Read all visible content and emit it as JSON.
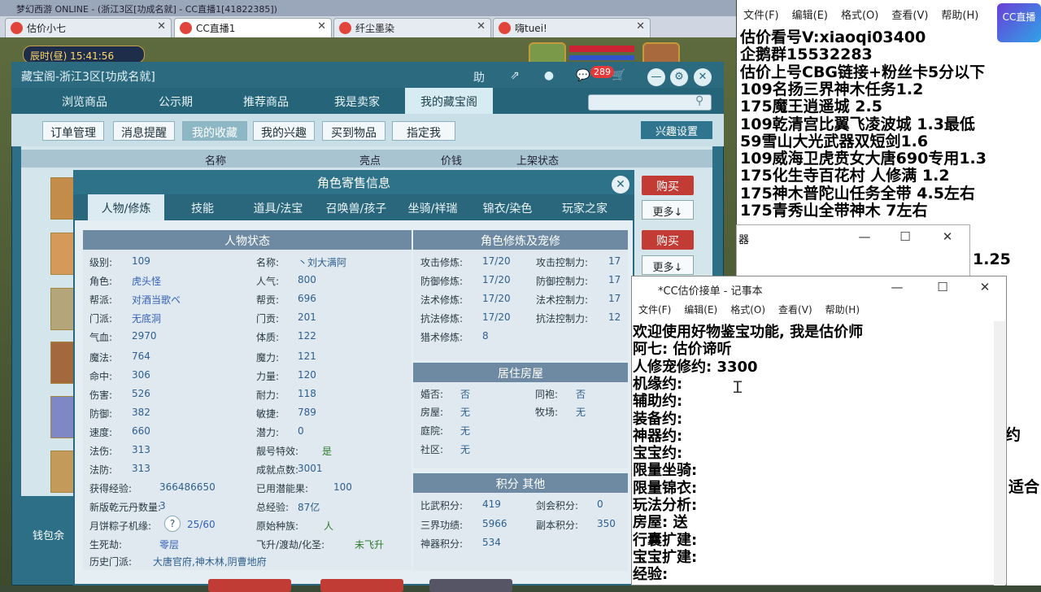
{
  "browser": {
    "window_title": "梦幻西游 ONLINE - (浙江3区[功成名就] - CC直播1[41822385])",
    "tabs": [
      {
        "label": "估价小七"
      },
      {
        "label": "CC直播1"
      },
      {
        "label": "纤尘墨染"
      },
      {
        "label": "嗨tuei!"
      }
    ]
  },
  "game": {
    "clock": "辰时(昼) 15:41:56",
    "cbg": {
      "title": "藏宝阁-浙江3区[功成名就]",
      "top_icons": {
        "help": "助",
        "share": "⇗",
        "stop": "●",
        "chat": "💬",
        "cart": "🛒"
      },
      "badge": "289",
      "nav_tabs": [
        "浏览商品",
        "公示期",
        "推荐商品",
        "我是卖家",
        "我的藏宝阁"
      ],
      "sub_tabs": [
        "订单管理",
        "消息提醒",
        "我的收藏",
        "我的兴趣",
        "买到物品",
        "指定我"
      ],
      "interest_button": "兴趣设置",
      "columns": [
        "名称",
        "亮点",
        "价钱",
        "上架状态"
      ],
      "buy_label": "购买",
      "more_label": "更多↓",
      "wallet": "钱包余"
    },
    "role": {
      "title": "角色寄售信息",
      "close": "✕",
      "tabs": [
        "人物/修炼",
        "技能",
        "道具/法宝",
        "召唤兽/孩子",
        "坐骑/祥瑞",
        "锦衣/染色",
        "玩家之家"
      ],
      "sections": {
        "status": "人物状态",
        "cultivation": "角色修炼及宠修",
        "house": "居住房屋",
        "points": "积分 其他"
      },
      "left": [
        [
          "级别:",
          "109",
          "名称:",
          "丶刘大满阿"
        ],
        [
          "角色:",
          "虎头怪",
          "人气:",
          "800"
        ],
        [
          "帮派:",
          "对酒当歌ベ",
          "帮贡:",
          "696"
        ],
        [
          "门派:",
          "无底洞",
          "门贡:",
          "201"
        ],
        [
          "气血:",
          "2970",
          "体质:",
          "122"
        ],
        [
          "魔法:",
          "764",
          "魔力:",
          "121"
        ],
        [
          "命中:",
          "306",
          "力量:",
          "120"
        ],
        [
          "伤害:",
          "526",
          "耐力:",
          "118"
        ],
        [
          "防御:",
          "382",
          "敏捷:",
          "789"
        ],
        [
          "速度:",
          "660",
          "潜力:",
          "0"
        ],
        [
          "法伤:",
          "313",
          "靓号特效:",
          "是"
        ],
        [
          "法防:",
          "313",
          "成就点数:",
          "3001"
        ],
        [
          "获得经验:",
          "366486650",
          "已用潜能果:",
          "100"
        ],
        [
          "新版乾元丹数量:",
          "3",
          "总经验:",
          "87亿"
        ],
        [
          "月饼粽子机缘:",
          "25/60",
          "原始种族:",
          "人"
        ],
        [
          "生死劫:",
          "零层",
          "飞升/渡劫/化圣:",
          "未飞升"
        ]
      ],
      "history": {
        "label": "历史门派:",
        "value": "大唐官府,神木林,阴曹地府"
      },
      "qmark": "?",
      "cult": [
        [
          "攻击修炼:",
          "17/20",
          "攻击控制力:",
          "17"
        ],
        [
          "防御修炼:",
          "17/20",
          "防御控制力:",
          "17"
        ],
        [
          "法术修炼:",
          "17/20",
          "法术控制力:",
          "17"
        ],
        [
          "抗法修炼:",
          "17/20",
          "抗法控制力:",
          "12"
        ],
        [
          "猎术修炼:",
          "8",
          "",
          ""
        ]
      ],
      "house": [
        [
          "婚否:",
          "否",
          "同袍:",
          "否"
        ],
        [
          "房屋:",
          "无",
          "牧场:",
          "无"
        ],
        [
          "庭院:",
          "无",
          "",
          ""
        ],
        [
          "社区:",
          "无",
          "",
          ""
        ]
      ],
      "points": [
        [
          "比武积分:",
          "419",
          "剑会积分:",
          "0"
        ],
        [
          "三界功绩:",
          "5966",
          "副本积分:",
          "350"
        ],
        [
          "神器积分:",
          "534",
          "",
          ""
        ]
      ]
    }
  },
  "notepad_back": {
    "menu": [
      "文件(F)",
      "编辑(E)",
      "格式(O)",
      "查看(V)",
      "帮助(H)"
    ],
    "lines": [
      "估价看号V:xiaoqi03400",
      "企鹅群15532283",
      "估价上号CBG链接+粉丝卡5分以下",
      "109名扬三界神木任务1.2",
      "175魔王逍遥城 2.5",
      "109乾清宫比翼飞凌波城 1.3最低",
      "59雪山大光武器双短剑1.6",
      "109威海卫虎贲女大唐690专用1.3",
      "175化生寺百花村 人修满 1.2",
      "175神木普陀山任务全带 4.5左右",
      "175青秀山全带神木  7左右"
    ],
    "partial": [
      "1.25",
      "约",
      "适合"
    ],
    "logo": "CC直播",
    "middle_window": {
      "title": "器",
      "controls": [
        "—",
        "☐",
        "✕"
      ]
    }
  },
  "notepad_front": {
    "title": "*CC估价接单 - 记事本",
    "controls": [
      "—",
      "☐",
      "✕"
    ],
    "menu": [
      "文件(F)",
      "编辑(E)",
      "格式(O)",
      "查看(V)",
      "帮助(H)"
    ],
    "lines": [
      "欢迎使用好物鉴宝功能, 我是估价师",
      "阿七: 估价谛听",
      "人修宠修约: 3300",
      "机缘约:",
      "辅助约:",
      "装备约:",
      "神器约:",
      "宝宝约:",
      "限量坐骑:",
      "限量锦衣:",
      "玩法分析:",
      "房屋: 送",
      "行囊扩建:",
      "宝宝扩建:",
      "经验:"
    ]
  }
}
